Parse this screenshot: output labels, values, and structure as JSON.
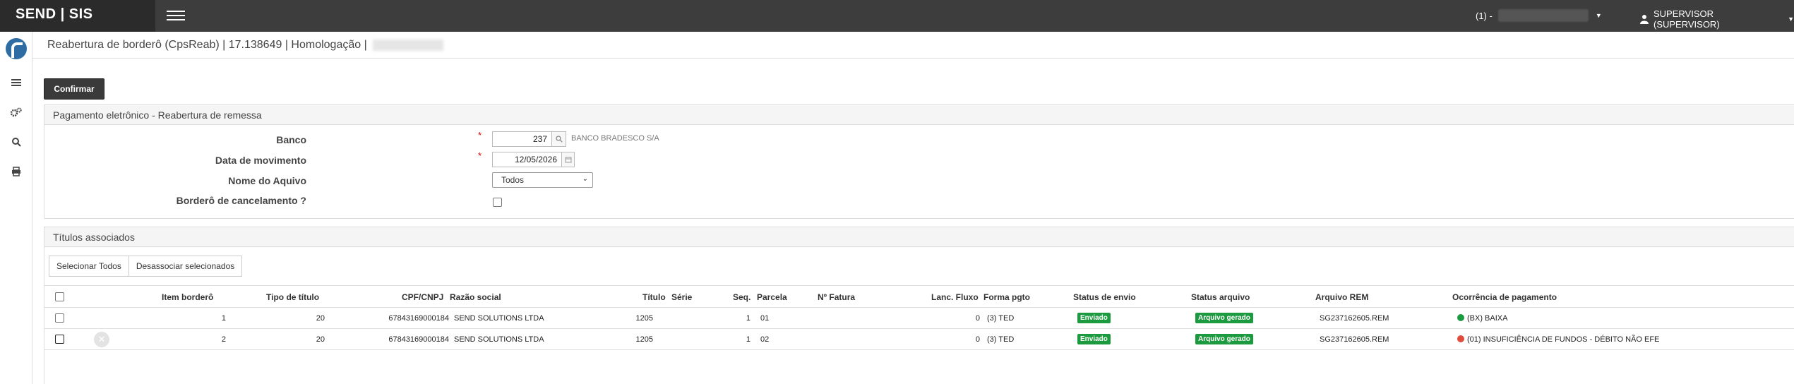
{
  "header": {
    "brand": "SEND | SIS",
    "tenant_prefix": "(1) -",
    "user_label": "SUPERVISOR (SUPERVISOR)"
  },
  "breadcrumb": {
    "text": "Reabertura de borderô (CpsReab) | 17.138649 | Homologação |"
  },
  "actions": {
    "confirm_label": "Confirmar"
  },
  "filter_panel": {
    "title": "Pagamento eletrônico - Reabertura de remessa",
    "banco_label": "Banco",
    "banco_value": "237",
    "banco_name": "BANCO BRADESCO S/A",
    "data_label": "Data de movimento",
    "data_value": "12/05/2026",
    "arquivo_label": "Nome do Aquivo",
    "arquivo_value": "Todos",
    "cancel_label": "Borderô de cancelamento ?",
    "required_mark": "*"
  },
  "titles_panel": {
    "title": "Títulos associados",
    "select_all_label": "Selecionar Todos",
    "disassociate_label": "Desassociar selecionados",
    "columns": {
      "item": "Item borderô",
      "tipo": "Tipo de título",
      "cpf": "CPF/CNPJ",
      "razao": "Razão social",
      "titulo": "Título",
      "serie": "Série",
      "seq": "Seq.",
      "parcela": "Parcela",
      "fatura": "Nº Fatura",
      "lanc": "Lanc. Fluxo",
      "forma": "Forma pgto",
      "status_envio": "Status de envio",
      "status_arquivo": "Status arquivo",
      "arquivo_rem": "Arquivo REM",
      "ocorrencia": "Ocorrência de pagamento"
    },
    "rows": [
      {
        "item": "1",
        "tipo": "20",
        "cpf": "67843169000184",
        "razao": "SEND SOLUTIONS LTDA",
        "titulo": "1205",
        "serie": "",
        "seq": "1",
        "parcela": "01",
        "fatura": "",
        "lanc": "0",
        "forma": "(3) TED",
        "status_envio": "Enviado",
        "status_arquivo": "Arquivo gerado",
        "arquivo_rem": "SG237162605.REM",
        "ocorrencia": "(BX) BAIXA",
        "dot_color": "#1c9a3f"
      },
      {
        "item": "2",
        "tipo": "20",
        "cpf": "67843169000184",
        "razao": "SEND SOLUTIONS LTDA",
        "titulo": "1205",
        "serie": "",
        "seq": "1",
        "parcela": "02",
        "fatura": "",
        "lanc": "0",
        "forma": "(3) TED",
        "status_envio": "Enviado",
        "status_arquivo": "Arquivo gerado",
        "arquivo_rem": "SG237162605.REM",
        "ocorrencia": "(01) INSUFICIÊNCIA DE FUNDOS - DÉBITO NÃO EFE",
        "dot_color": "#e04b3c"
      }
    ]
  },
  "icons": {
    "rail": [
      "logo-icon",
      "list-icon",
      "settings-icon",
      "search-icon",
      "print-icon"
    ]
  }
}
